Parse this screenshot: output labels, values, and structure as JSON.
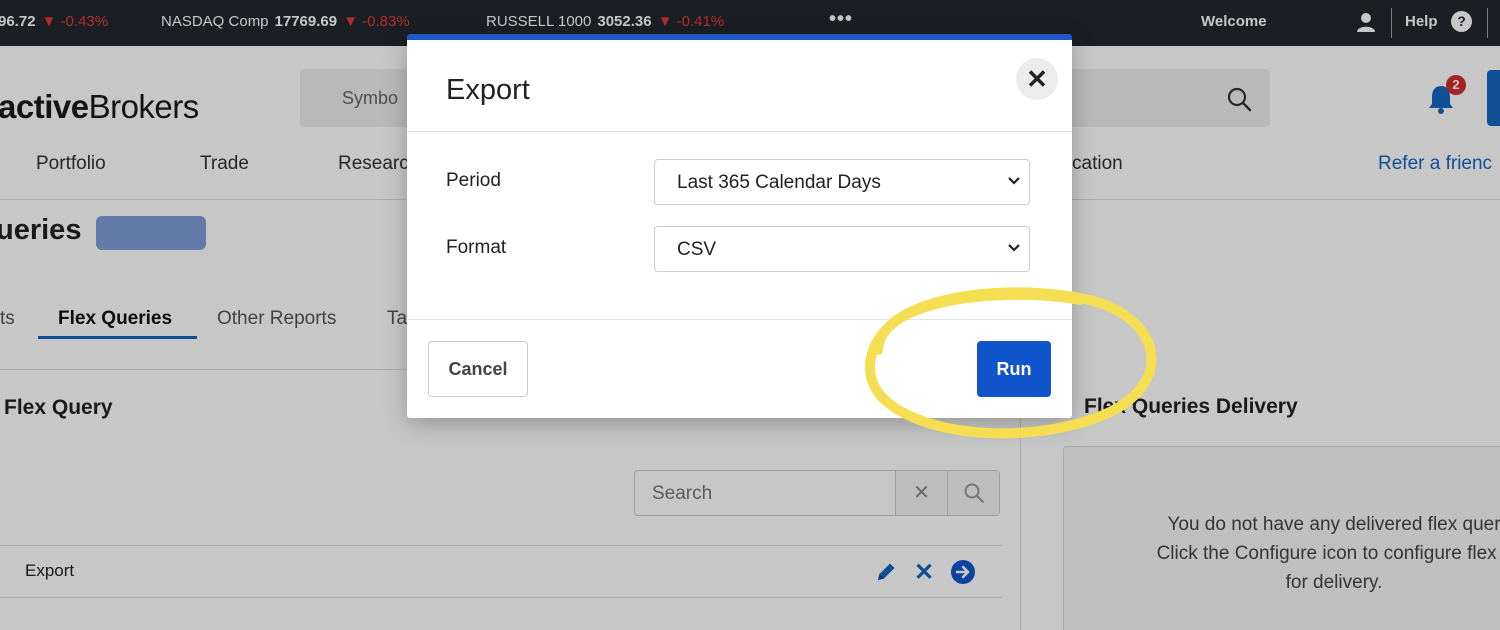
{
  "ticker": {
    "items": [
      {
        "name": "",
        "value": "96.72",
        "change": "-0.43%"
      },
      {
        "name": "NASDAQ Comp",
        "value": "17769.69",
        "change": "-0.83%"
      },
      {
        "name": "RUSSELL 1000",
        "value": "3052.36",
        "change": "-0.41%"
      }
    ],
    "more": "•••",
    "welcome": "Welcome",
    "help": "Help",
    "help_icon": "?"
  },
  "header": {
    "logo_bold": "active",
    "logo_regular": "Brokers",
    "search_placeholder": "Symbo",
    "notification_count": "2"
  },
  "nav": {
    "items": [
      "Portfolio",
      "Trade",
      "Researc",
      "cation"
    ],
    "refer": "Refer a frienc"
  },
  "page": {
    "title": "ueries",
    "tabs": [
      "ts",
      "Flex Queries",
      "Other Reports",
      "Ta"
    ],
    "active_tab": "Flex Queries",
    "panel_title": "Flex Query",
    "delivery_title": "Flex Queries Delivery",
    "search_placeholder": "Search",
    "rows": [
      {
        "name": "Export"
      }
    ],
    "empty_lines": [
      "You do not have any delivered flex quer",
      "Click the Configure icon to configure flex c",
      "for delivery."
    ]
  },
  "modal": {
    "title": "Export",
    "close": "✕",
    "period_label": "Period",
    "period_value": "Last 365 Calendar Days",
    "format_label": "Format",
    "format_value": "CSV",
    "cancel": "Cancel",
    "run": "Run"
  },
  "colors": {
    "accent": "#1155cc",
    "ticker_bg": "#23272e",
    "negative": "#e53935",
    "highlight": "#f6de52"
  }
}
